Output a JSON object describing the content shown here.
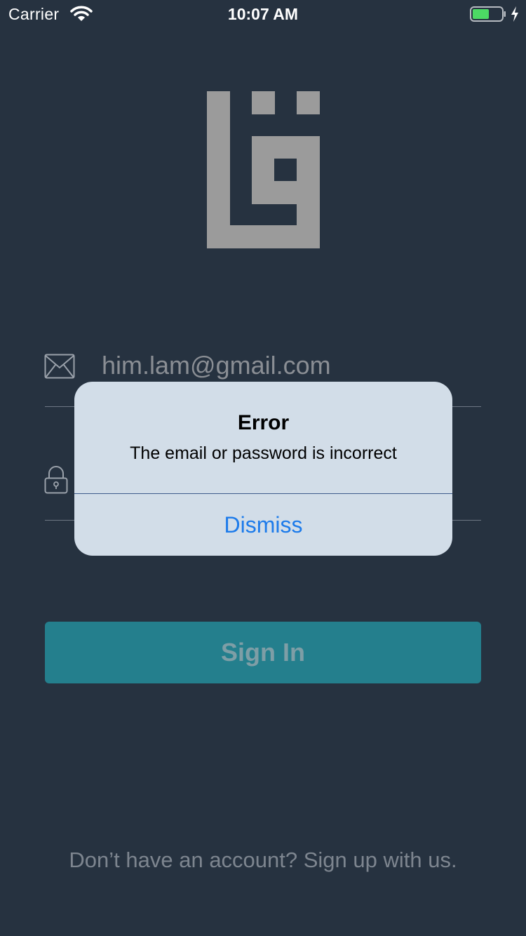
{
  "status_bar": {
    "carrier": "Carrier",
    "time": "10:07 AM",
    "icons": [
      "wifi-icon",
      "battery-icon",
      "charging-bolt-icon"
    ]
  },
  "logo": {
    "icon": "square-kufic-logo"
  },
  "email_field": {
    "icon": "envelope-icon",
    "value": "him.lam@gmail.com"
  },
  "password_field": {
    "icon": "lock-icon",
    "value": ""
  },
  "sign_in_button": {
    "label": "Sign In"
  },
  "signup_link": {
    "label": "Don’t have an account? Sign up with us."
  },
  "alert": {
    "title": "Error",
    "message": "The email or password is incorrect",
    "dismiss_label": "Dismiss"
  },
  "colors": {
    "background": "#263240",
    "button": "#247f8d",
    "alert_background": "#d2dde8",
    "alert_action": "#1d7bea",
    "logo": "#9b9b9b"
  }
}
